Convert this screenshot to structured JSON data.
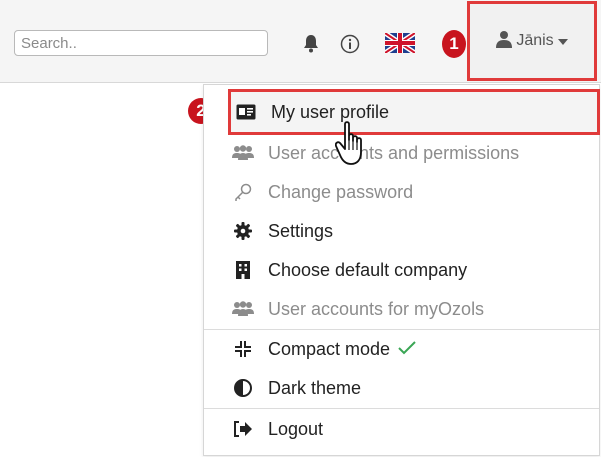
{
  "topbar": {
    "search": {
      "placeholder": "Search..",
      "value": ""
    },
    "icons": [
      "bell-icon",
      "info-icon",
      "uk-flag-icon"
    ],
    "user": {
      "name": "Jānis"
    }
  },
  "markers": {
    "one": "1",
    "two": "2"
  },
  "menu": {
    "items": [
      {
        "label": "My user profile",
        "icon": "id-card-icon",
        "state": "highlighted"
      },
      {
        "label": "User accounts and permissions",
        "icon": "users-icon",
        "state": "disabled"
      },
      {
        "label": "Change password",
        "icon": "key-icon",
        "state": "disabled"
      },
      {
        "label": "Settings",
        "icon": "gear-icon",
        "state": "normal"
      },
      {
        "label": "Choose default company",
        "icon": "building-icon",
        "state": "normal"
      },
      {
        "label": "User accounts for myOzols",
        "icon": "users-icon",
        "state": "disabled"
      },
      {
        "label": "Compact mode",
        "icon": "compress-icon",
        "state": "checked"
      },
      {
        "label": "Dark theme",
        "icon": "contrast-icon",
        "state": "normal"
      },
      {
        "label": "Logout",
        "icon": "sign-out-icon",
        "state": "normal"
      }
    ]
  },
  "colors": {
    "highlight_border": "#e03a3a",
    "marker": "#c8141e",
    "check": "#3aa655",
    "disabled_text": "#8c8c8c"
  }
}
